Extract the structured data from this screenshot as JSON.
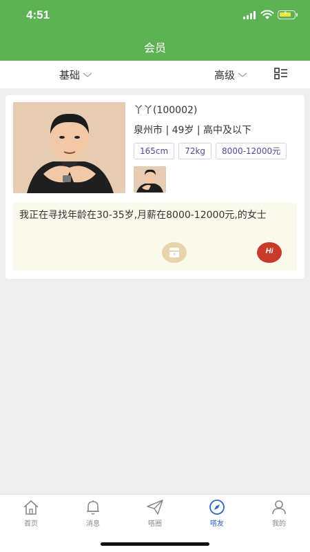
{
  "status_bar": {
    "time": "4:51"
  },
  "header": {
    "title": "会员"
  },
  "filters": {
    "basic": "基础",
    "advanced": "高级"
  },
  "member": {
    "name": "丫丫(100002)",
    "meta": "泉州市 | 49岁 | 高中及以下",
    "tags": [
      "165cm",
      "72kg",
      "8000-12000元"
    ],
    "bio": "我正在寻找年龄在30-35岁,月薪在8000-12000元,的女士",
    "hi_label": "Hi"
  },
  "tabbar": {
    "items": [
      {
        "label": "首页",
        "icon": "home-icon"
      },
      {
        "label": "消息",
        "icon": "bell-icon"
      },
      {
        "label": "嗒圈",
        "icon": "paper-plane-icon"
      },
      {
        "label": "嗒友",
        "icon": "compass-icon"
      },
      {
        "label": "我的",
        "icon": "person-icon"
      }
    ],
    "active_index": 3
  },
  "colors": {
    "header_green": "#5db353",
    "tag_text": "#4b4d9a",
    "active_tab": "#2b64c8",
    "hi_red": "#c83a2a"
  }
}
